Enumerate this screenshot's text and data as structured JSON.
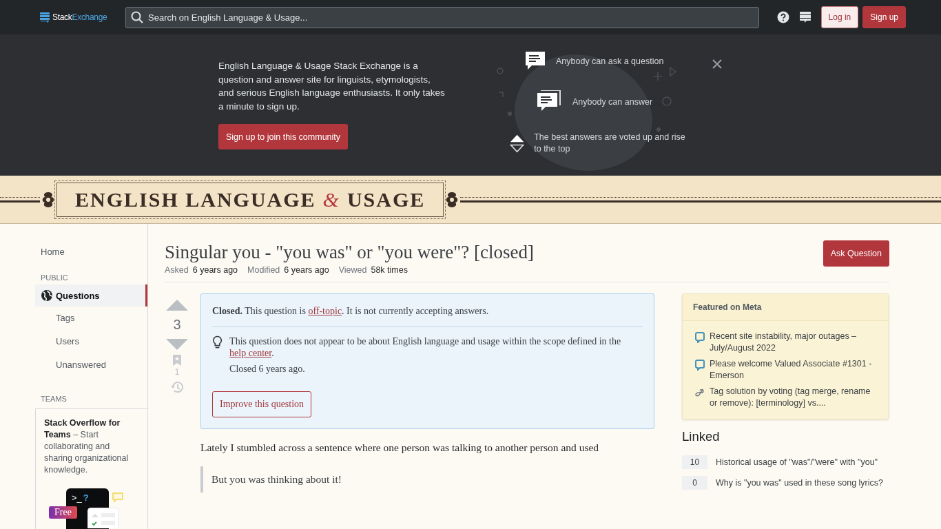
{
  "topbar": {
    "logo": {
      "part_1": "Stack",
      "part_2": "Exchange"
    },
    "search": {
      "placeholder": "Search on English Language & Usage..."
    },
    "login": "Log in",
    "signup": "Sign up"
  },
  "banner": {
    "text": "English Language & Usage Stack Exchange is a question and answer site for linguists, etymologists, and serious English language enthusiasts. It only takes a minute to sign up.",
    "button": "Sign up to join this community",
    "points": [
      {
        "kind": "ask",
        "text": "Anybody can ask a question"
      },
      {
        "kind": "answer",
        "text": "Anybody can answer"
      },
      {
        "kind": "vote",
        "text": "The best answers are voted up and rise to the top"
      }
    ]
  },
  "site_header": {
    "title_1": "ENGLISH LANGUAGE",
    "ampersand": "&",
    "title_2": "USAGE"
  },
  "sidebar": {
    "home": "Home",
    "public_label": "PUBLIC",
    "items": [
      {
        "label": "Questions",
        "selected": true,
        "children": [
          {
            "label": "Tags",
            "selected": false
          },
          {
            "label": "Users",
            "selected": false
          },
          {
            "label": "Unanswered",
            "selected": false
          }
        ]
      }
    ],
    "teams_label": "TEAMS",
    "teams": {
      "title": "Stack Overflow for Teams",
      "text": " – Start collaborating and sharing organizational knowledge.",
      "prompt": ">_",
      "prompt_mark": "?",
      "badge": "Free"
    }
  },
  "question": {
    "title": "Singular you - \"you was\" or \"you were\"? [closed]",
    "ask_button": "Ask Question",
    "meta": [
      {
        "label": "Asked",
        "value": "6 years ago"
      },
      {
        "label": "Modified",
        "value": "6 years ago"
      },
      {
        "label": "Viewed",
        "value": "58k times"
      }
    ],
    "votes": "3",
    "bookmarks": "1",
    "notice": {
      "head_before": "**Closed.** This question is ",
      "head_link": "off-topic",
      "head_after": ". It is not currently accepting answers.",
      "reason_before": "This question does not appear to be about English language and usage within the scope defined in the ",
      "reason_link": "help center",
      "reason_after": ".",
      "closed": "Closed 6 years ago.",
      "button": "Improve this question"
    },
    "body": "Lately I stumbled across a sentence where one person was talking to another person and used",
    "quote": "But you was thinking about it!"
  },
  "featured": {
    "title": "Featured on Meta",
    "items": [
      {
        "kind": "meta",
        "text": "Recent site instability, major outages – July/August 2022"
      },
      {
        "kind": "meta",
        "text": "Please welcome Valued Associate #1301 - Emerson"
      },
      {
        "kind": "tag",
        "text": "Tag solution by voting (tag merge, rename or remove): [terminology] vs...."
      }
    ]
  },
  "linked": {
    "title": "Linked",
    "items": [
      {
        "score": "10",
        "text": "Historical usage of \"was\"/\"were\" with \"you\""
      },
      {
        "score": "0",
        "text": "Why is \"you was\" used in these song lyrics?"
      }
    ]
  }
}
